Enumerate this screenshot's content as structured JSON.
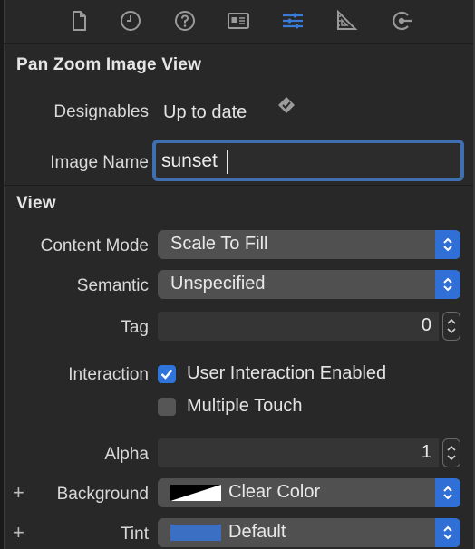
{
  "toolbar": {
    "icons": [
      "file-icon",
      "clock-icon",
      "help-icon",
      "identity-icon",
      "attributes-icon",
      "ruler-icon",
      "connections-icon"
    ],
    "active": "attributes-icon"
  },
  "custom_section": {
    "title": "Pan Zoom Image View",
    "designables_label": "Designables",
    "designables_value": "Up to date",
    "image_name_label": "Image Name",
    "image_name_value": "sunset"
  },
  "view_section": {
    "title": "View",
    "content_mode_label": "Content Mode",
    "content_mode_value": "Scale To Fill",
    "semantic_label": "Semantic",
    "semantic_value": "Unspecified",
    "tag_label": "Tag",
    "tag_value": "0",
    "interaction_label": "Interaction",
    "user_interaction_label": "User Interaction Enabled",
    "user_interaction_checked": true,
    "multiple_touch_label": "Multiple Touch",
    "multiple_touch_checked": false,
    "alpha_label": "Alpha",
    "alpha_value": "1",
    "background_label": "Background",
    "background_value": "Clear Color",
    "tint_label": "Tint",
    "tint_value": "Default",
    "plus_symbol": "+"
  },
  "colors": {
    "accent": "#2f6fd6",
    "tint_swatch": "#3b6fc4",
    "focus_ring": "#3f6fb0"
  }
}
